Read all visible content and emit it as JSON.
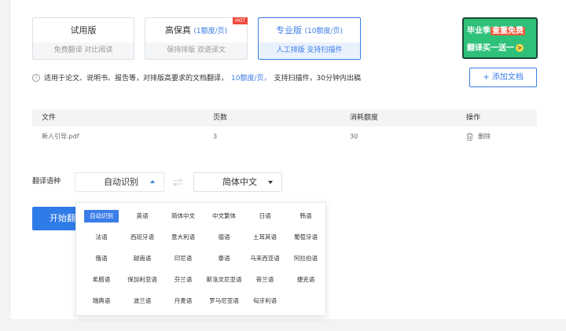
{
  "plans": [
    {
      "title": "试用版",
      "rate": "",
      "sub": "免费翻译  对比阅读",
      "hot": ""
    },
    {
      "title": "高保真",
      "rate": "(1额度/页)",
      "sub": "保持排版  双语译文",
      "hot": "HOT"
    },
    {
      "title": "专业版",
      "rate": "(10额度/页)",
      "sub": "人工排版  支持扫描件",
      "hot": ""
    }
  ],
  "promo": {
    "line1_a": "毕业季",
    "line1_b": "查重免费",
    "line2": "翻译买一送一",
    "arrow": ">"
  },
  "info": {
    "icon": "!",
    "text_a": "适用于论文、说明书、报告等，对排版高要求的文档翻译，",
    "rate": "10额度/页，",
    "text_b": "支持扫描件，30分钟内出稿"
  },
  "add_button": "+ 添加文档",
  "table": {
    "headers": [
      "文件",
      "页数",
      "消耗额度",
      "操作"
    ],
    "rows": [
      {
        "file": "新人引导.pdf",
        "pages": "3",
        "credits": "30",
        "action": "删除"
      }
    ]
  },
  "translate": {
    "label": "翻译语种",
    "source": "自动识别",
    "target": "简体中文",
    "start_button": "开始翻译"
  },
  "languages": [
    "自动识别",
    "英语",
    "简体中文",
    "中文繁体",
    "日语",
    "韩语",
    "法语",
    "西班牙语",
    "意大利语",
    "德语",
    "土耳其语",
    "葡萄牙语",
    "俄语",
    "越南语",
    "印尼语",
    "泰语",
    "马来西亚语",
    "阿拉伯语",
    "希腊语",
    "保加利亚语",
    "芬兰语",
    "斯洛文尼亚语",
    "荷兰语",
    "捷克语",
    "瑞典语",
    "波兰语",
    "丹麦语",
    "罗马尼亚语",
    "匈牙利语"
  ],
  "colors": {
    "accent": "#3b7de8",
    "hot": "#f04a3c",
    "promo": "#2fc07a"
  }
}
